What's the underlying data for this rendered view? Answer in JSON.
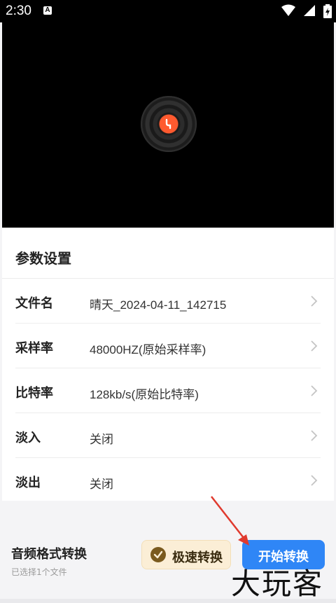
{
  "status_bar": {
    "time": "2:30",
    "notif_badge": "A"
  },
  "player": {
    "disc_icon": "vinyl-disc-icon"
  },
  "settings": {
    "title": "参数设置",
    "rows": [
      {
        "label": "文件名",
        "value": "晴天_2024-04-11_142715"
      },
      {
        "label": "采样率",
        "value": "48000HZ(原始采样率)"
      },
      {
        "label": "比特率",
        "value": "128kb/s(原始比特率)"
      },
      {
        "label": "淡入",
        "value": "关闭"
      },
      {
        "label": "淡出",
        "value": "关闭"
      }
    ]
  },
  "bottom_bar": {
    "title": "音频格式转换",
    "subtitle": "已选择1个文件",
    "fast_label": "极速转换",
    "start_label": "开始转换"
  },
  "watermark": "大玩客",
  "colors": {
    "accent": "#2f86f6",
    "disc_center": "#ff5a2f",
    "fast_bg": "#fbeed6",
    "arrow": "#e03a2e"
  }
}
